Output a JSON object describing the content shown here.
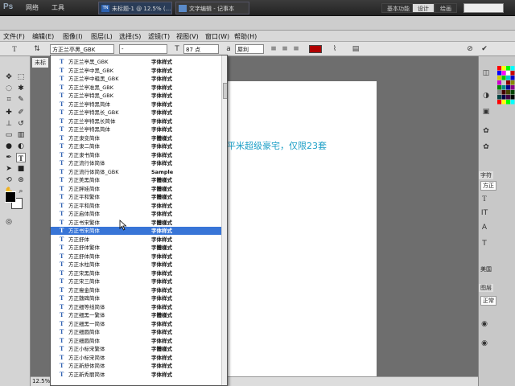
{
  "app": {
    "logo": "Ps",
    "menus": [
      "网络",
      "工具"
    ],
    "tabs": [
      {
        "icon": "TN",
        "label": "未标题-1 @ 12.5% (..."
      },
      {
        "label": "文字编辑 - 记事本"
      }
    ],
    "workspaces": [
      "基本功能",
      "设计",
      "绘画",
      "摄影"
    ],
    "active_workspace": "设计"
  },
  "menubar": [
    "文件(F)",
    "编辑(E)",
    "图像(I)",
    "图层(L)",
    "选择(S)",
    "滤镜(T)",
    "视图(V)",
    "窗口(W)",
    "帮助(H)"
  ],
  "options": {
    "tool_icon": "T",
    "font_family": "方正兰亭黑_GBK",
    "font_style": "-",
    "font_size": "87 点",
    "antialias": "犀利"
  },
  "document": {
    "tab_label": "未标",
    "canvas_text": "平米超级豪宅，仅限23套",
    "zoom": "12.5%"
  },
  "right_panel": {
    "char_tab": "字符",
    "char_font": "方正",
    "lang": "美国",
    "layers_tab": "图层",
    "blend": "正常"
  },
  "font_list": [
    {
      "name": "方正兰亭黑_GBK",
      "sample": "字体样式"
    },
    {
      "name": "方正兰亭中黑_GBK",
      "sample": "字体样式"
    },
    {
      "name": "方正兰亭中粗黑_GBK",
      "sample": "字体样式"
    },
    {
      "name": "方正兰亭准黑_GBK",
      "sample": "字体样式"
    },
    {
      "name": "方正兰亭特黑_GBK",
      "sample": "字体样式"
    },
    {
      "name": "方正兰亭特黑简体",
      "sample": "字体样式"
    },
    {
      "name": "方正兰亭特黑长_GBK",
      "sample": "字体样式"
    },
    {
      "name": "方正兰亭特黑长简体",
      "sample": "字体样式"
    },
    {
      "name": "方正兰亭特黑简体",
      "sample": "字体样式"
    },
    {
      "name": "方正隶变简体",
      "sample": "字體樣式"
    },
    {
      "name": "方正隶二简体",
      "sample": "字体样式"
    },
    {
      "name": "方正隶书简体",
      "sample": "字体样式"
    },
    {
      "name": "方正流行体简体",
      "sample": "字体样式"
    },
    {
      "name": "方正流行体简体_GBK",
      "sample": "Sample"
    },
    {
      "name": "方正美黑简体",
      "sample": "字體樣式"
    },
    {
      "name": "方正胖娃简体",
      "sample": "字體樣式"
    },
    {
      "name": "方正平和繁体",
      "sample": "字體樣式"
    },
    {
      "name": "方正平和简体",
      "sample": "字体样式"
    },
    {
      "name": "方正启体简体",
      "sample": "字体样式"
    },
    {
      "name": "方正书宋繁体",
      "sample": "字體樣式"
    },
    {
      "name": "方正书宋简体",
      "sample": "字体样式"
    },
    {
      "name": "方正舒体",
      "sample": "字体样式"
    },
    {
      "name": "方正舒体繁体",
      "sample": "字體樣式"
    },
    {
      "name": "方正舒体简体",
      "sample": "字体样式"
    },
    {
      "name": "方正水柱简体",
      "sample": "字体样式"
    },
    {
      "name": "方正宋黑简体",
      "sample": "字体样式"
    },
    {
      "name": "方正宋三简体",
      "sample": "字体样式"
    },
    {
      "name": "方正瘦金简体",
      "sample": "字体样式"
    },
    {
      "name": "方正魏碑简体",
      "sample": "字体样式"
    },
    {
      "name": "方正细等线简体",
      "sample": "字体样式"
    },
    {
      "name": "方正细黑一繁体",
      "sample": "字體樣式"
    },
    {
      "name": "方正细黑一简体",
      "sample": "字体样式"
    },
    {
      "name": "方正细圆简体",
      "sample": "字体样式"
    },
    {
      "name": "方正细圆简体",
      "sample": "字体样式"
    },
    {
      "name": "方正小标宋繁体",
      "sample": "字體樣式"
    },
    {
      "name": "方正小标宋简体",
      "sample": "字体样式"
    },
    {
      "name": "方正新舒体简体",
      "sample": "字体样式"
    },
    {
      "name": "方正新秀丽简体",
      "sample": "字体样式"
    }
  ],
  "selected_index": 20,
  "colors": {
    "accent": "#3875d7",
    "canvas_text": "#1a9ec6",
    "text_color_swatch": "#b00000"
  }
}
